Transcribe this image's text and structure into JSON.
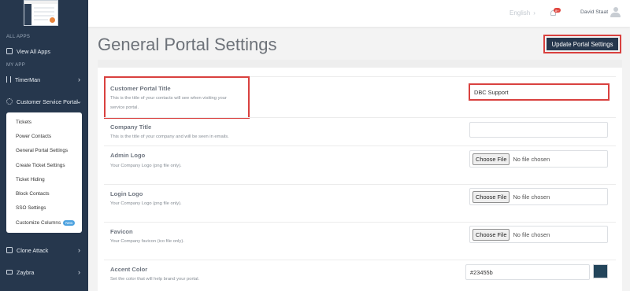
{
  "sidebar": {
    "sections": {
      "all_apps": "ALL APPS",
      "my_app": "MY APP"
    },
    "items": {
      "view_all_apps": "View All Apps",
      "timerman": "TimerMan",
      "customer_service_portal": "Customer Service Portal",
      "clone_attack": "Clone Attack",
      "zaybra": "Zaybra"
    },
    "submenu": [
      {
        "label": "Tickets"
      },
      {
        "label": "Power Contacts"
      },
      {
        "label": "General Portal Settings"
      },
      {
        "label": "Create Ticket Settings"
      },
      {
        "label": "Ticket Hiding"
      },
      {
        "label": "Block Contacts"
      },
      {
        "label": "SSO Settings"
      },
      {
        "label": "Customize Columns",
        "badge": "New"
      }
    ],
    "icons": [
      "apps-icon",
      "hourglass-icon",
      "gear-icon",
      "clone-icon",
      "card-icon",
      "chevron-right-icon",
      "chevron-down-icon"
    ]
  },
  "topbar": {
    "language": "English",
    "notification_count": "8+",
    "user_name": "David Staat"
  },
  "page": {
    "title": "General Portal Settings",
    "update_button": "Update Portal Settings"
  },
  "fields": {
    "portal_title": {
      "label": "Customer Portal Title",
      "desc_line1": "This is the title of your contacts will see when visiting your",
      "desc_line2": "service portal.",
      "value": "DBC Support"
    },
    "company_title": {
      "label": "Company Title",
      "desc": "This is the title of your company and will be seen in emails.",
      "value": ""
    },
    "admin_logo": {
      "label": "Admin Logo",
      "desc": "Your Company Logo (png file only).",
      "button": "Choose File",
      "status": "No file chosen"
    },
    "login_logo": {
      "label": "Login Logo",
      "desc": "Your Company Logo (png file only).",
      "button": "Choose File",
      "status": "No file chosen"
    },
    "favicon": {
      "label": "Favicon",
      "desc": "Your Company favicon (ico file only).",
      "button": "Choose File",
      "status": "No file chosen"
    },
    "accent_color": {
      "label": "Accent Color",
      "desc": "Set the color that will help brand your portal.",
      "value": "#23455b"
    }
  },
  "colors": {
    "sidebar_bg": "#26374d",
    "highlight_red": "#d9413f",
    "accent_swatch": "#23455b"
  }
}
